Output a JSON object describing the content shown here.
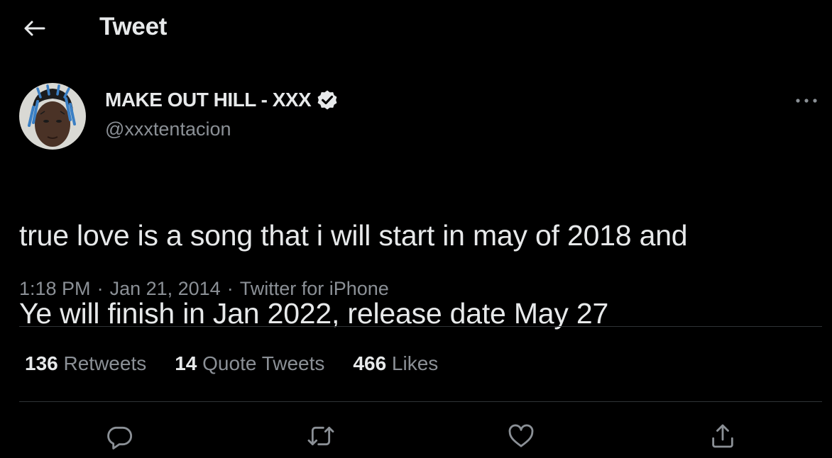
{
  "header": {
    "title": "Tweet"
  },
  "tweet": {
    "display_name": "MAKE OUT HILL - XXX",
    "handle": "@xxxtentacion",
    "text_line1": "true love is a song that i will start in may of 2018 and",
    "text_line2": "Ye will finish in Jan 2022, release date May 27",
    "time": "1:18 PM",
    "separator": "·",
    "date": "Jan 21, 2014",
    "source": "Twitter for iPhone"
  },
  "stats": {
    "retweets_count": "136",
    "retweets_label": "Retweets",
    "quotes_count": "14",
    "quotes_label": "Quote Tweets",
    "likes_count": "466",
    "likes_label": "Likes"
  },
  "icons": {
    "back": "arrow-left-icon",
    "verified": "verified-badge-icon",
    "more": "more-horizontal-icon",
    "reply": "reply-icon",
    "retweet": "retweet-icon",
    "like": "heart-icon",
    "share": "share-icon"
  },
  "colors": {
    "background": "#000000",
    "primary_text": "#e7e9ea",
    "secondary_text": "#8b9096",
    "divider": "#2f3336"
  }
}
